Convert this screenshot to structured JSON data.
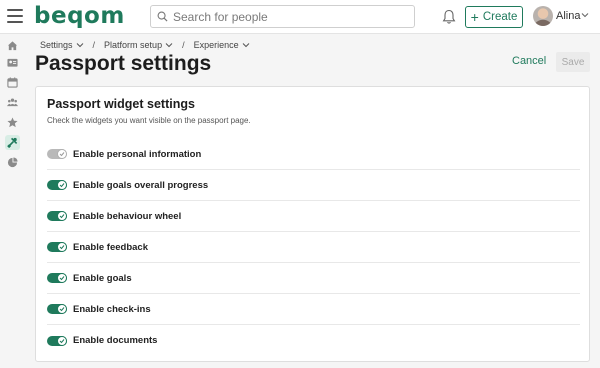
{
  "app": {
    "logo": "beqom",
    "search": {
      "placeholder": "Search for people"
    },
    "create_label": "Create",
    "user_name": "Alina"
  },
  "breadcrumb": {
    "items": [
      "Settings",
      "Platform setup",
      "Experience"
    ],
    "separator": "/"
  },
  "page": {
    "title": "Passport settings",
    "cancel_label": "Cancel",
    "save_label": "Save"
  },
  "card": {
    "title": "Passport widget settings",
    "subtitle": "Check the widgets you want visible on the passport page.",
    "widgets": [
      {
        "label": "Enable personal information",
        "enabled": true,
        "disabled": true
      },
      {
        "label": "Enable goals overall progress",
        "enabled": true,
        "disabled": false
      },
      {
        "label": "Enable behaviour wheel",
        "enabled": true,
        "disabled": false
      },
      {
        "label": "Enable feedback",
        "enabled": true,
        "disabled": false
      },
      {
        "label": "Enable goals",
        "enabled": true,
        "disabled": false
      },
      {
        "label": "Enable check-ins",
        "enabled": true,
        "disabled": false
      },
      {
        "label": "Enable documents",
        "enabled": true,
        "disabled": false
      }
    ]
  },
  "nav_icons": [
    "home-icon",
    "contact-card-icon",
    "calendar-icon",
    "people-icon",
    "star-badge-icon",
    "tools-icon",
    "pie-chart-icon"
  ],
  "colors": {
    "brand": "#1f7a5c",
    "toggle_disabled": "#b9b9b9",
    "nav_active_bg": "#d8ede5"
  }
}
